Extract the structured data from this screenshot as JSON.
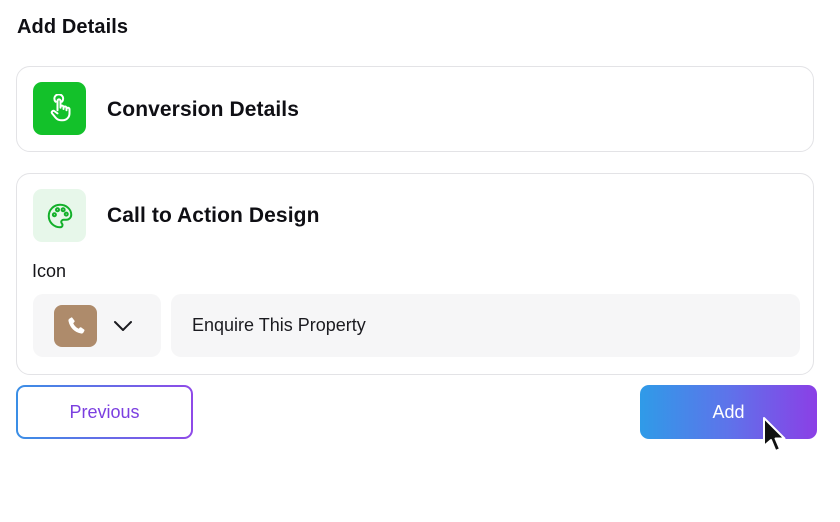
{
  "page": {
    "title": "Add Details"
  },
  "conversion_card": {
    "title": "Conversion Details",
    "icon": "tap-hand-icon",
    "icon_bg": "#13c12a"
  },
  "cta_card": {
    "title": "Call to Action Design",
    "icon": "palette-icon",
    "icon_bg": "#e7f7ea",
    "icon_label": "Icon",
    "selected_icon": "phone-icon",
    "selected_icon_bg": "#ae8b6b",
    "button_text_value": "Enquire This Property"
  },
  "actions": {
    "previous_label": "Previous",
    "add_label": "Add",
    "accent_start": "#2f9be8",
    "accent_end": "#8b3fe6"
  }
}
